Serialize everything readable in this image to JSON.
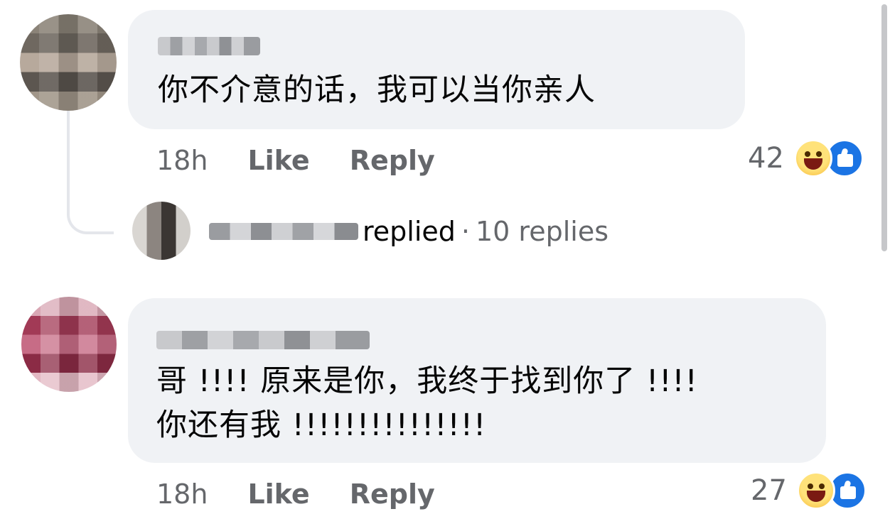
{
  "comments": [
    {
      "text": "你不介意的话，我可以当你亲人",
      "time": "18h",
      "like_label": "Like",
      "reply_label": "Reply",
      "reaction_count": "42",
      "reactions": [
        "haha-icon",
        "like-icon"
      ]
    },
    {
      "text": "哥 !!!! 原来是你，我终于找到你了 !!!!\n你还有我 !!!!!!!!!!!!!!!",
      "time": "18h",
      "like_label": "Like",
      "reply_label": "Reply",
      "reaction_count": "27",
      "reactions": [
        "haha-icon",
        "like-icon"
      ]
    }
  ],
  "reply_summary": {
    "action": "replied",
    "separator": "·",
    "count_label": "10 replies"
  },
  "colors": {
    "bubble": "#f0f2f5",
    "meta_text": "#65676b",
    "like_blue": "#1b74e4"
  }
}
